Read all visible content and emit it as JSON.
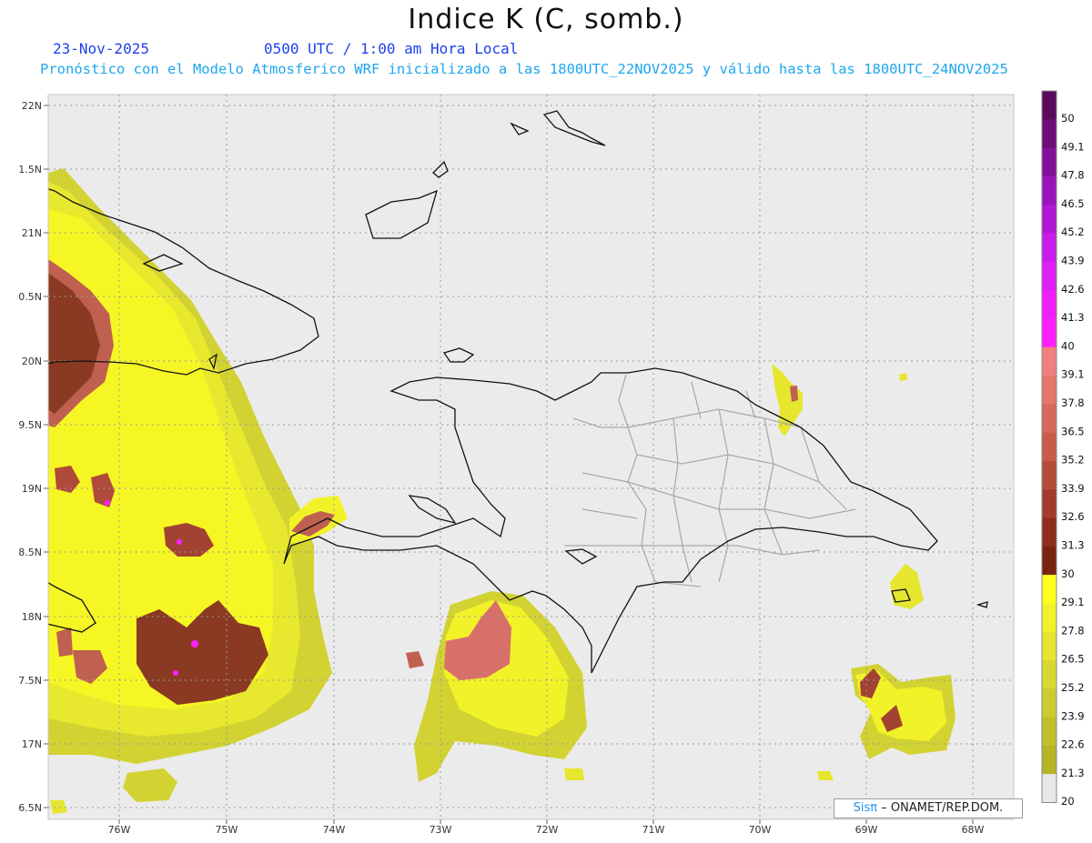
{
  "title": "Indice K (C, somb.)",
  "date": "23-Nov-2025",
  "time": "0500 UTC / 1:00 am Hora Local",
  "info": "Pronóstico con el Modelo Atmosferico WRF inicializado a las 1800UTC_22NOV2025 y válido hasta las  1800UTC_24NOV2025",
  "credit": {
    "brand": "Sisπ",
    "text": "– ONAMET/REP.DOM."
  },
  "lat_labels": [
    "22N",
    "1.5N",
    "21N",
    "0.5N",
    "20N",
    "9.5N",
    "19N",
    "8.5N",
    "18N",
    "7.5N",
    "17N",
    "6.5N"
  ],
  "lon_labels": [
    "76W",
    "75W",
    "74W",
    "73W",
    "72W",
    "71W",
    "70W",
    "69W",
    "68W"
  ],
  "colorbar": {
    "levels": [
      "50",
      "49.1",
      "47.8",
      "46.5",
      "45.2",
      "43.9",
      "42.6",
      "41.3",
      "40",
      "39.1",
      "37.8",
      "36.5",
      "35.2",
      "33.9",
      "32.6",
      "31.3",
      "30",
      "29.1",
      "27.8",
      "26.5",
      "25.2",
      "23.9",
      "22.6",
      "21.3",
      "20"
    ],
    "colors": [
      "#5a0a5a",
      "#6e0c78",
      "#84109a",
      "#9a14bc",
      "#b018d4",
      "#c81cea",
      "#de20f6",
      "#f020fa",
      "#ff20ff",
      "#f08080",
      "#e6776c",
      "#d8695a",
      "#c75c4a",
      "#b54c3a",
      "#a23c2a",
      "#8e2e1c",
      "#7a2410",
      "#ffff20",
      "#f2f22a",
      "#e6e62e",
      "#d8d830",
      "#cccc2e",
      "#c0c02a",
      "#b4b426",
      "#e8e8e8"
    ]
  },
  "colors": {
    "background": "#ebebeb",
    "coast": "#111111",
    "provinces": "#a8a8a8",
    "grid": "#9a9a9a"
  }
}
